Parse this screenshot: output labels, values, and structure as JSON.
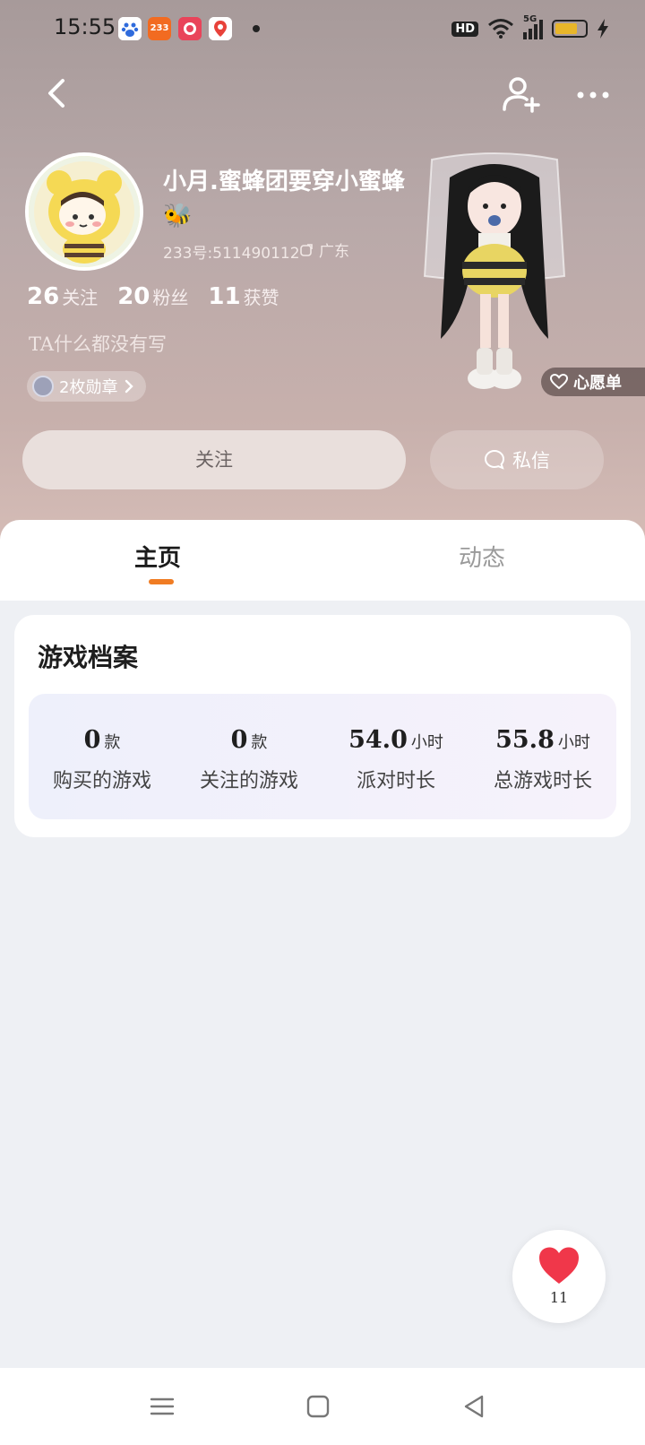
{
  "status_bar": {
    "time": "15:55",
    "apps": [
      {
        "icon": "baidu-app-icon",
        "color": "#2f6bdc",
        "label": ""
      },
      {
        "icon": "233-app-icon",
        "color": "#f26b21",
        "label": "233"
      },
      {
        "icon": "pinduoduo-app-icon",
        "color": "#e9445a",
        "label": ""
      },
      {
        "icon": "map-app-icon",
        "color": "#e8423a",
        "label": ""
      }
    ],
    "hd": "HD",
    "network": "5G"
  },
  "profile": {
    "nickname": "小月.蜜蜂团要穿小蜜蜂🐝",
    "user_id": "233号:511490112",
    "location": "广东",
    "stats": [
      {
        "value": "26",
        "label": "关注"
      },
      {
        "value": "20",
        "label": "粉丝"
      },
      {
        "value": "11",
        "label": "获赞"
      }
    ],
    "bio": "TA什么都没有写",
    "badges_label": "2枚勋章",
    "wishlist_label": "心愿单"
  },
  "actions": {
    "follow": "关注",
    "message": "私信"
  },
  "tabs": [
    {
      "label": "主页",
      "active": true
    },
    {
      "label": "动态",
      "active": false
    }
  ],
  "game_profile": {
    "title": "游戏档案",
    "stats": [
      {
        "value": "0",
        "unit": "款",
        "label": "购买的游戏"
      },
      {
        "value": "0",
        "unit": "款",
        "label": "关注的游戏"
      },
      {
        "value": "54.0",
        "unit": "小时",
        "label": "派对时长"
      },
      {
        "value": "55.8",
        "unit": "小时",
        "label": "总游戏时长"
      }
    ]
  },
  "like": {
    "count": "11"
  },
  "colors": {
    "accent": "#f07c23",
    "heart": "#f0374a"
  }
}
